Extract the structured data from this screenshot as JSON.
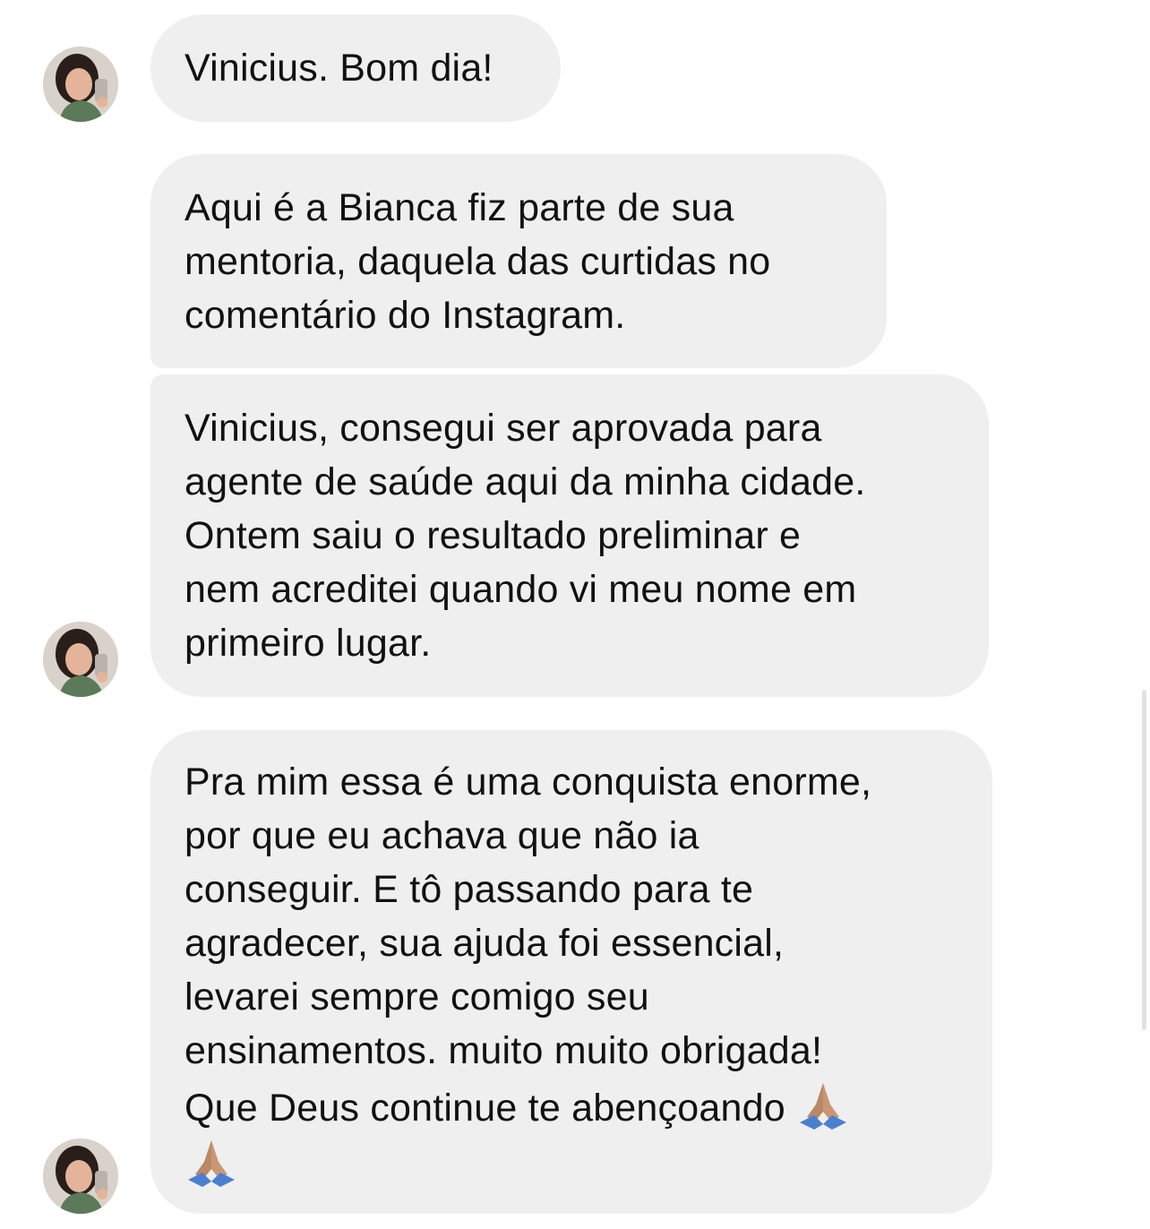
{
  "messages": [
    {
      "sender": "contact",
      "lines": [
        "Vinicius. Bom dia!"
      ]
    },
    {
      "sender": "contact",
      "lines": [
        "Aqui é a Bianca fiz parte de sua",
        "mentoria, daquela das curtidas no",
        "comentário do Instagram."
      ]
    },
    {
      "sender": "contact",
      "lines": [
        "Vinicius, consegui ser aprovada para",
        "agente de saúde aqui da minha cidade.",
        "Ontem saiu o resultado preliminar e",
        "nem acreditei quando vi meu nome em",
        "primeiro lugar."
      ]
    },
    {
      "sender": "contact",
      "lines": [
        "Pra mim essa é uma conquista enorme,",
        "por que eu achava que não ia",
        "conseguir. E tô passando para te",
        "agradecer, sua ajuda foi essencial,",
        "levarei sempre comigo seu",
        "ensinamentos. muito muito obrigada!",
        "Que Deus continue te abençoando"
      ],
      "emoji": "folded-hands-icon"
    }
  ],
  "colors": {
    "bubble_background": "#efefef",
    "text": "#111111",
    "page_background": "#ffffff"
  }
}
